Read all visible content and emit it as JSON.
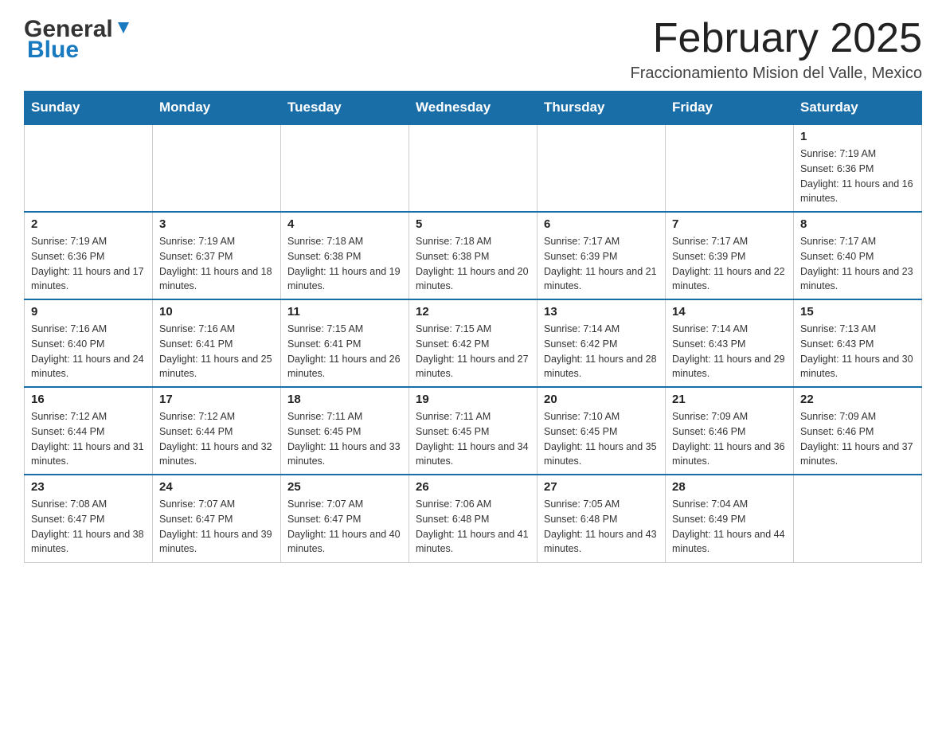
{
  "logo": {
    "text_general": "General",
    "text_blue": "Blue"
  },
  "header": {
    "title": "February 2025",
    "subtitle": "Fraccionamiento Mision del Valle, Mexico"
  },
  "days_of_week": [
    "Sunday",
    "Monday",
    "Tuesday",
    "Wednesday",
    "Thursday",
    "Friday",
    "Saturday"
  ],
  "weeks": [
    {
      "days": [
        {
          "num": "",
          "info": ""
        },
        {
          "num": "",
          "info": ""
        },
        {
          "num": "",
          "info": ""
        },
        {
          "num": "",
          "info": ""
        },
        {
          "num": "",
          "info": ""
        },
        {
          "num": "",
          "info": ""
        },
        {
          "num": "1",
          "info": "Sunrise: 7:19 AM\nSunset: 6:36 PM\nDaylight: 11 hours and 16 minutes."
        }
      ]
    },
    {
      "days": [
        {
          "num": "2",
          "info": "Sunrise: 7:19 AM\nSunset: 6:36 PM\nDaylight: 11 hours and 17 minutes."
        },
        {
          "num": "3",
          "info": "Sunrise: 7:19 AM\nSunset: 6:37 PM\nDaylight: 11 hours and 18 minutes."
        },
        {
          "num": "4",
          "info": "Sunrise: 7:18 AM\nSunset: 6:38 PM\nDaylight: 11 hours and 19 minutes."
        },
        {
          "num": "5",
          "info": "Sunrise: 7:18 AM\nSunset: 6:38 PM\nDaylight: 11 hours and 20 minutes."
        },
        {
          "num": "6",
          "info": "Sunrise: 7:17 AM\nSunset: 6:39 PM\nDaylight: 11 hours and 21 minutes."
        },
        {
          "num": "7",
          "info": "Sunrise: 7:17 AM\nSunset: 6:39 PM\nDaylight: 11 hours and 22 minutes."
        },
        {
          "num": "8",
          "info": "Sunrise: 7:17 AM\nSunset: 6:40 PM\nDaylight: 11 hours and 23 minutes."
        }
      ]
    },
    {
      "days": [
        {
          "num": "9",
          "info": "Sunrise: 7:16 AM\nSunset: 6:40 PM\nDaylight: 11 hours and 24 minutes."
        },
        {
          "num": "10",
          "info": "Sunrise: 7:16 AM\nSunset: 6:41 PM\nDaylight: 11 hours and 25 minutes."
        },
        {
          "num": "11",
          "info": "Sunrise: 7:15 AM\nSunset: 6:41 PM\nDaylight: 11 hours and 26 minutes."
        },
        {
          "num": "12",
          "info": "Sunrise: 7:15 AM\nSunset: 6:42 PM\nDaylight: 11 hours and 27 minutes."
        },
        {
          "num": "13",
          "info": "Sunrise: 7:14 AM\nSunset: 6:42 PM\nDaylight: 11 hours and 28 minutes."
        },
        {
          "num": "14",
          "info": "Sunrise: 7:14 AM\nSunset: 6:43 PM\nDaylight: 11 hours and 29 minutes."
        },
        {
          "num": "15",
          "info": "Sunrise: 7:13 AM\nSunset: 6:43 PM\nDaylight: 11 hours and 30 minutes."
        }
      ]
    },
    {
      "days": [
        {
          "num": "16",
          "info": "Sunrise: 7:12 AM\nSunset: 6:44 PM\nDaylight: 11 hours and 31 minutes."
        },
        {
          "num": "17",
          "info": "Sunrise: 7:12 AM\nSunset: 6:44 PM\nDaylight: 11 hours and 32 minutes."
        },
        {
          "num": "18",
          "info": "Sunrise: 7:11 AM\nSunset: 6:45 PM\nDaylight: 11 hours and 33 minutes."
        },
        {
          "num": "19",
          "info": "Sunrise: 7:11 AM\nSunset: 6:45 PM\nDaylight: 11 hours and 34 minutes."
        },
        {
          "num": "20",
          "info": "Sunrise: 7:10 AM\nSunset: 6:45 PM\nDaylight: 11 hours and 35 minutes."
        },
        {
          "num": "21",
          "info": "Sunrise: 7:09 AM\nSunset: 6:46 PM\nDaylight: 11 hours and 36 minutes."
        },
        {
          "num": "22",
          "info": "Sunrise: 7:09 AM\nSunset: 6:46 PM\nDaylight: 11 hours and 37 minutes."
        }
      ]
    },
    {
      "days": [
        {
          "num": "23",
          "info": "Sunrise: 7:08 AM\nSunset: 6:47 PM\nDaylight: 11 hours and 38 minutes."
        },
        {
          "num": "24",
          "info": "Sunrise: 7:07 AM\nSunset: 6:47 PM\nDaylight: 11 hours and 39 minutes."
        },
        {
          "num": "25",
          "info": "Sunrise: 7:07 AM\nSunset: 6:47 PM\nDaylight: 11 hours and 40 minutes."
        },
        {
          "num": "26",
          "info": "Sunrise: 7:06 AM\nSunset: 6:48 PM\nDaylight: 11 hours and 41 minutes."
        },
        {
          "num": "27",
          "info": "Sunrise: 7:05 AM\nSunset: 6:48 PM\nDaylight: 11 hours and 43 minutes."
        },
        {
          "num": "28",
          "info": "Sunrise: 7:04 AM\nSunset: 6:49 PM\nDaylight: 11 hours and 44 minutes."
        },
        {
          "num": "",
          "info": ""
        }
      ]
    }
  ]
}
